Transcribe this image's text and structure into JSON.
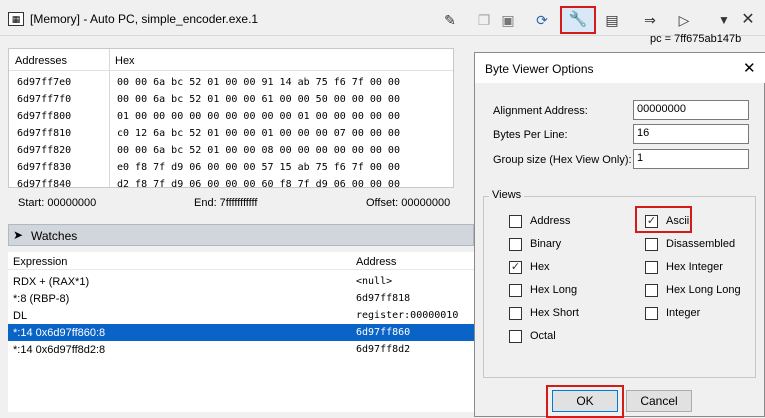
{
  "window": {
    "title": "[Memory] - Auto PC, simple_encoder.exe.1",
    "pc_readout": "pc = 7ff675ab147b"
  },
  "toolbar": {
    "icons": [
      "edit-icon",
      "copy-icon",
      "paste-icon",
      "refresh-icon",
      "wrench-icon",
      "snapshot-icon",
      "goto-arrow-icon",
      "cursor-icon",
      "menu-down-icon",
      "close-icon"
    ]
  },
  "memory": {
    "col_addresses": "Addresses",
    "col_hex": "Hex",
    "rows": [
      {
        "addr": "6d97ff7e0",
        "hex": "00 00 6a bc 52 01 00 00 91 14 ab 75 f6 7f 00 00"
      },
      {
        "addr": "6d97ff7f0",
        "hex": "00 00 6a bc 52 01 00 00 61 00 00 50 00 00 00 00"
      },
      {
        "addr": "6d97ff800",
        "hex": "01 00 00 00 00 00 00 00 00 00 01 00 00 00 00 00"
      },
      {
        "addr": "6d97ff810",
        "hex": "c0 12 6a bc 52 01 00 00 01 00 00 00 07 00 00 00"
      },
      {
        "addr": "6d97ff820",
        "hex": "00 00 6a bc 52 01 00 00 08 00 00 00 00 00 00 00"
      },
      {
        "addr": "6d97ff830",
        "hex": "e0 f8 7f d9 06 00 00 00 57 15 ab 75 f6 7f 00 00"
      },
      {
        "addr": "6d97ff840",
        "hex": "d2 f8 7f d9 06 00 00 00 60 f8 7f d9 06 00 00 00"
      }
    ]
  },
  "status": {
    "start": "Start: 00000000",
    "end": "End: 7fffffffffff",
    "offset": "Offset: 00000000"
  },
  "watches": {
    "title": "Watches",
    "col_expression": "Expression",
    "col_address": "Address",
    "rows": [
      {
        "expr": "RDX + (RAX*1)",
        "addr": "<null>"
      },
      {
        "expr": "*:8 (RBP-8)",
        "addr": "6d97ff818"
      },
      {
        "expr": "DL",
        "addr": "register:00000010"
      },
      {
        "expr": "*:14 0x6d97ff860:8",
        "addr": "6d97ff860"
      },
      {
        "expr": "*:14 0x6d97ff8d2:8",
        "addr": "6d97ff8d2"
      }
    ]
  },
  "dialog": {
    "title": "Byte Viewer Options",
    "alignment_label": "Alignment Address:",
    "alignment_value": "00000000",
    "bytes_label": "Bytes Per Line:",
    "bytes_value": "16",
    "group_label": "Group size (Hex View Only):",
    "group_value": "1",
    "views_legend": "Views",
    "views": {
      "address": {
        "label": "Address",
        "checked": false
      },
      "ascii": {
        "label": "Ascii",
        "checked": true
      },
      "binary": {
        "label": "Binary",
        "checked": false
      },
      "disassembled": {
        "label": "Disassembled",
        "checked": false
      },
      "hex": {
        "label": "Hex",
        "checked": true
      },
      "hex_integer": {
        "label": "Hex Integer",
        "checked": false
      },
      "hex_long": {
        "label": "Hex Long",
        "checked": false
      },
      "hex_long_long": {
        "label": "Hex Long Long",
        "checked": false
      },
      "hex_short": {
        "label": "Hex Short",
        "checked": false
      },
      "integer": {
        "label": "Integer",
        "checked": false
      },
      "octal": {
        "label": "Octal",
        "checked": false
      }
    },
    "ok_label": "OK",
    "cancel_label": "Cancel"
  },
  "colors": {
    "highlight_red": "#d51a1a",
    "selection_blue": "#0a64c8"
  }
}
